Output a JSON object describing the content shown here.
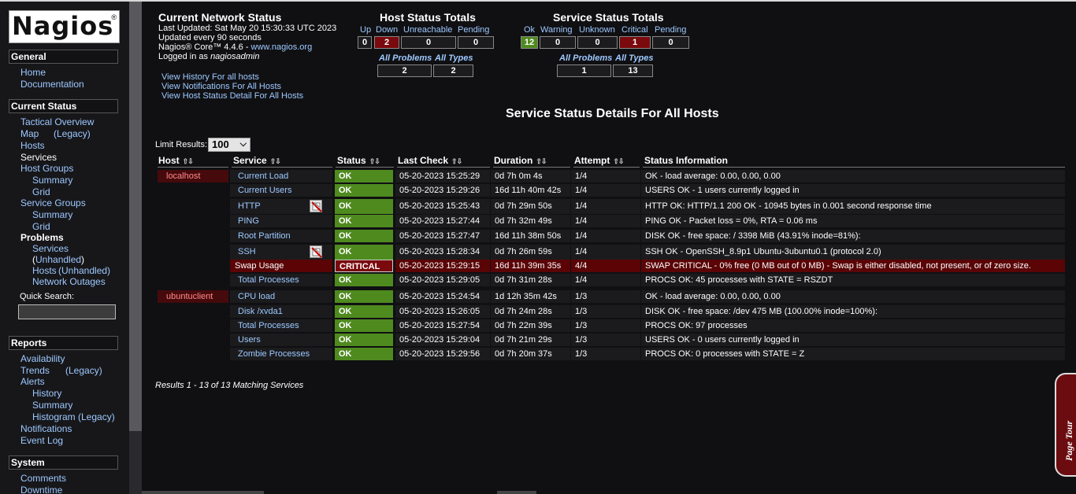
{
  "sidebar": {
    "logo": "Nagios",
    "logo_reg": "®",
    "general_header": "General",
    "home": "Home",
    "documentation": "Documentation",
    "current_status_header": "Current Status",
    "tactical_overview": "Tactical Overview",
    "map": "Map",
    "map_legacy": "(Legacy)",
    "hosts": "Hosts",
    "services": "Services",
    "host_groups": "Host Groups",
    "hg_summary": "Summary",
    "hg_grid": "Grid",
    "service_groups": "Service Groups",
    "sg_summary": "Summary",
    "sg_grid": "Grid",
    "problems": "Problems",
    "prob_services": "Services",
    "prob_unhandled_open": "(",
    "prob_unhandled": "Unhandled",
    "prob_unhandled_close": ")",
    "prob_hosts": "Hosts",
    "prob_hosts_unhandled": "(Unhandled)",
    "network_outages": "Network Outages",
    "quick_search_label": "Quick Search:",
    "quick_search_value": "",
    "reports_header": "Reports",
    "availability": "Availability",
    "trends": "Trends",
    "trends_legacy": "(Legacy)",
    "alerts": "Alerts",
    "alerts_history": "History",
    "alerts_summary": "Summary",
    "alerts_histogram": "Histogram (Legacy)",
    "notifications": "Notifications",
    "event_log": "Event Log",
    "system_header": "System",
    "comments": "Comments",
    "downtime": "Downtime"
  },
  "network_status": {
    "title": "Current Network Status",
    "last_updated": "Last Updated: Sat May 20 15:30:33 UTC 2023",
    "update_interval": "Updated every 90 seconds",
    "version_prefix": "Nagios® Core™ 4.4.6 - ",
    "version_link": "www.nagios.org",
    "logged_in_prefix": "Logged in as ",
    "logged_in_user": "nagiosadmin",
    "links": [
      "View History For all hosts",
      "View Notifications For All Hosts",
      "View Host Status Detail For All Hosts"
    ]
  },
  "host_totals": {
    "title": "Host Status Totals",
    "labels": [
      "Up",
      "Down",
      "Unreachable",
      "Pending"
    ],
    "values": [
      "0",
      "2",
      "0",
      "0"
    ],
    "all_problems_label": "All Problems",
    "all_types_label": "All Types",
    "all_problems": "2",
    "all_types": "2"
  },
  "service_totals": {
    "title": "Service Status Totals",
    "labels": [
      "Ok",
      "Warning",
      "Unknown",
      "Critical",
      "Pending"
    ],
    "values": [
      "12",
      "0",
      "0",
      "1",
      "0"
    ],
    "all_problems_label": "All Problems",
    "all_types_label": "All Types",
    "all_problems": "1",
    "all_types": "13"
  },
  "details": {
    "title": "Service Status Details For All Hosts",
    "limit_label": "Limit Results:",
    "limit_value": "100",
    "columns": [
      "Host",
      "Service",
      "Status",
      "Last Check",
      "Duration",
      "Attempt",
      "Status Information"
    ],
    "footer": "Results 1 - 13 of 13 Matching Services"
  },
  "rows": [
    {
      "host": "localhost",
      "service": "Current Load",
      "status": "OK",
      "last_check": "05-20-2023 15:25:29",
      "duration": "0d 7h 0m 4s",
      "attempt": "1/4",
      "info": "OK - load average: 0.00, 0.00, 0.00"
    },
    {
      "host": "",
      "service": "Current Users",
      "status": "OK",
      "last_check": "05-20-2023 15:29:26",
      "duration": "16d 11h 40m 42s",
      "attempt": "1/4",
      "info": "USERS OK - 1 users currently logged in"
    },
    {
      "host": "",
      "service": "HTTP",
      "status": "OK",
      "last_check": "05-20-2023 15:25:43",
      "duration": "0d 7h 29m 50s",
      "attempt": "1/4",
      "info": "HTTP OK: HTTP/1.1 200 OK - 10945 bytes in 0.001 second response time"
    },
    {
      "host": "",
      "service": "PING",
      "status": "OK",
      "last_check": "05-20-2023 15:27:44",
      "duration": "0d 7h 32m 49s",
      "attempt": "1/4",
      "info": "PING OK - Packet loss = 0%, RTA = 0.06 ms"
    },
    {
      "host": "",
      "service": "Root Partition",
      "status": "OK",
      "last_check": "05-20-2023 15:27:47",
      "duration": "16d 11h 38m 50s",
      "attempt": "1/4",
      "info": "DISK OK - free space: / 3398 MiB (43.91% inode=81%):"
    },
    {
      "host": "",
      "service": "SSH",
      "status": "OK",
      "last_check": "05-20-2023 15:28:34",
      "duration": "0d 7h 26m 59s",
      "attempt": "1/4",
      "info": "SSH OK - OpenSSH_8.9p1 Ubuntu-3ubuntu0.1 (protocol 2.0)"
    },
    {
      "host": "",
      "service": "Swap Usage",
      "status": "CRITICAL",
      "last_check": "05-20-2023 15:29:15",
      "duration": "16d 11h 39m 35s",
      "attempt": "4/4",
      "info": "SWAP CRITICAL - 0% free (0 MB out of 0 MB) - Swap is either disabled, not present, or of zero size."
    },
    {
      "host": "",
      "service": "Total Processes",
      "status": "OK",
      "last_check": "05-20-2023 15:29:05",
      "duration": "0d 7h 31m 28s",
      "attempt": "1/4",
      "info": "PROCS OK: 45 processes with STATE = RSZDT"
    },
    {
      "host": "ubuntuclient",
      "service": "CPU load",
      "status": "OK",
      "last_check": "05-20-2023 15:24:54",
      "duration": "1d 12h 35m 42s",
      "attempt": "1/3",
      "info": "OK - load average: 0.00, 0.00, 0.00"
    },
    {
      "host": "",
      "service": "Disk /xvda1",
      "status": "OK",
      "last_check": "05-20-2023 15:26:05",
      "duration": "0d 7h 24m 28s",
      "attempt": "1/3",
      "info": "DISK OK - free space: /dev 475 MB (100.00% inode=100%):"
    },
    {
      "host": "",
      "service": "Total Processes",
      "status": "OK",
      "last_check": "05-20-2023 15:27:54",
      "duration": "0d 7h 22m 39s",
      "attempt": "1/3",
      "info": "PROCS OK: 97 processes"
    },
    {
      "host": "",
      "service": "Users",
      "status": "OK",
      "last_check": "05-20-2023 15:29:04",
      "duration": "0d 7h 21m 29s",
      "attempt": "1/3",
      "info": "USERS OK - 0 users currently logged in"
    },
    {
      "host": "",
      "service": "Zombie Processes",
      "status": "OK",
      "last_check": "05-20-2023 15:29:56",
      "duration": "0d 7h 20m 37s",
      "attempt": "1/3",
      "info": "PROCS OK: 0 processes with STATE = Z"
    }
  ],
  "page_tour": "Page Tour"
}
